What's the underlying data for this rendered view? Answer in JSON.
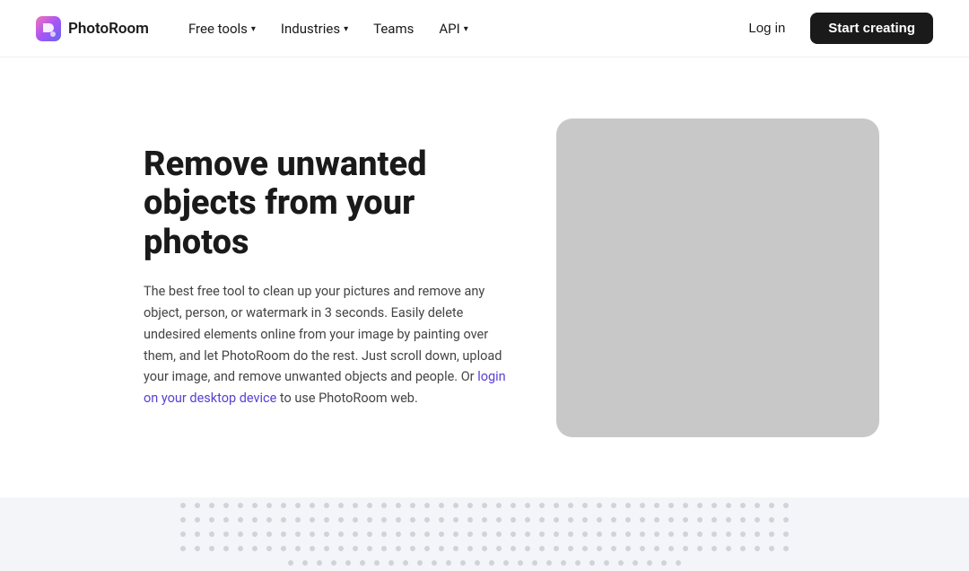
{
  "brand": {
    "logo_text": "PhotoRoom",
    "logo_icon_alt": "PhotoRoom logo"
  },
  "nav": {
    "links": [
      {
        "label": "Free tools",
        "has_dropdown": true
      },
      {
        "label": "Industries",
        "has_dropdown": true
      },
      {
        "label": "Teams",
        "has_dropdown": false
      },
      {
        "label": "API",
        "has_dropdown": true
      }
    ],
    "login_label": "Log in",
    "cta_label": "Start creating"
  },
  "hero": {
    "title": "Remove unwanted objects from your photos",
    "description_part1": "The best free tool to clean up your pictures and remove any object, person, or watermark in 3 seconds. Easily delete undesired elements online from your image by painting over them, and let PhotoRoom do the rest. Just scroll down, upload your image, and remove unwanted objects and people. Or ",
    "link_text": "login on your desktop device",
    "description_part2": " to use PhotoRoom web."
  }
}
